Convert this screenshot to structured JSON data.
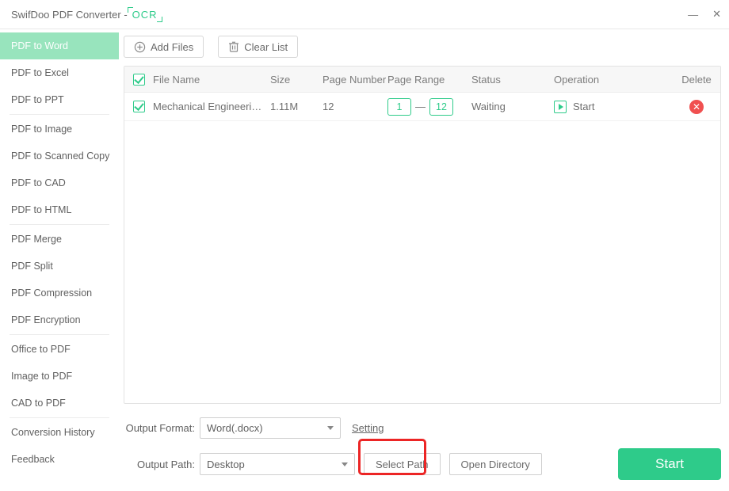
{
  "titlebar": {
    "app_title": "SwifDoo PDF Converter -",
    "ocr": "OCR"
  },
  "sidebar": {
    "groups": [
      [
        "PDF to Word",
        "PDF to Excel",
        "PDF to PPT"
      ],
      [
        "PDF to Image",
        "PDF to Scanned Copy",
        "PDF to CAD",
        "PDF to HTML"
      ],
      [
        "PDF Merge",
        "PDF Split",
        "PDF Compression",
        "PDF Encryption"
      ],
      [
        "Office to PDF",
        "Image to PDF",
        "CAD to PDF"
      ],
      [
        "Conversion History",
        "Feedback"
      ]
    ],
    "active_index": 0
  },
  "toolbar": {
    "add_files": "Add Files",
    "clear_list": "Clear List"
  },
  "table": {
    "headers": {
      "file_name": "File Name",
      "size": "Size",
      "page_number": "Page Number",
      "page_range": "Page Range",
      "status": "Status",
      "operation": "Operation",
      "delete": "Delete"
    },
    "row": {
      "checked": true,
      "file_name": "Mechanical Engineering...",
      "size": "1.11M",
      "page_number": "12",
      "range_from": "1",
      "range_to": "12",
      "range_dash": "—",
      "status": "Waiting",
      "operation_label": "Start"
    }
  },
  "output": {
    "format_label": "Output Format:",
    "format_value": "Word(.docx)",
    "setting": "Setting",
    "path_label": "Output Path:",
    "path_value": "Desktop",
    "select_path": "Select Path",
    "open_dir": "Open Directory",
    "start": "Start"
  }
}
